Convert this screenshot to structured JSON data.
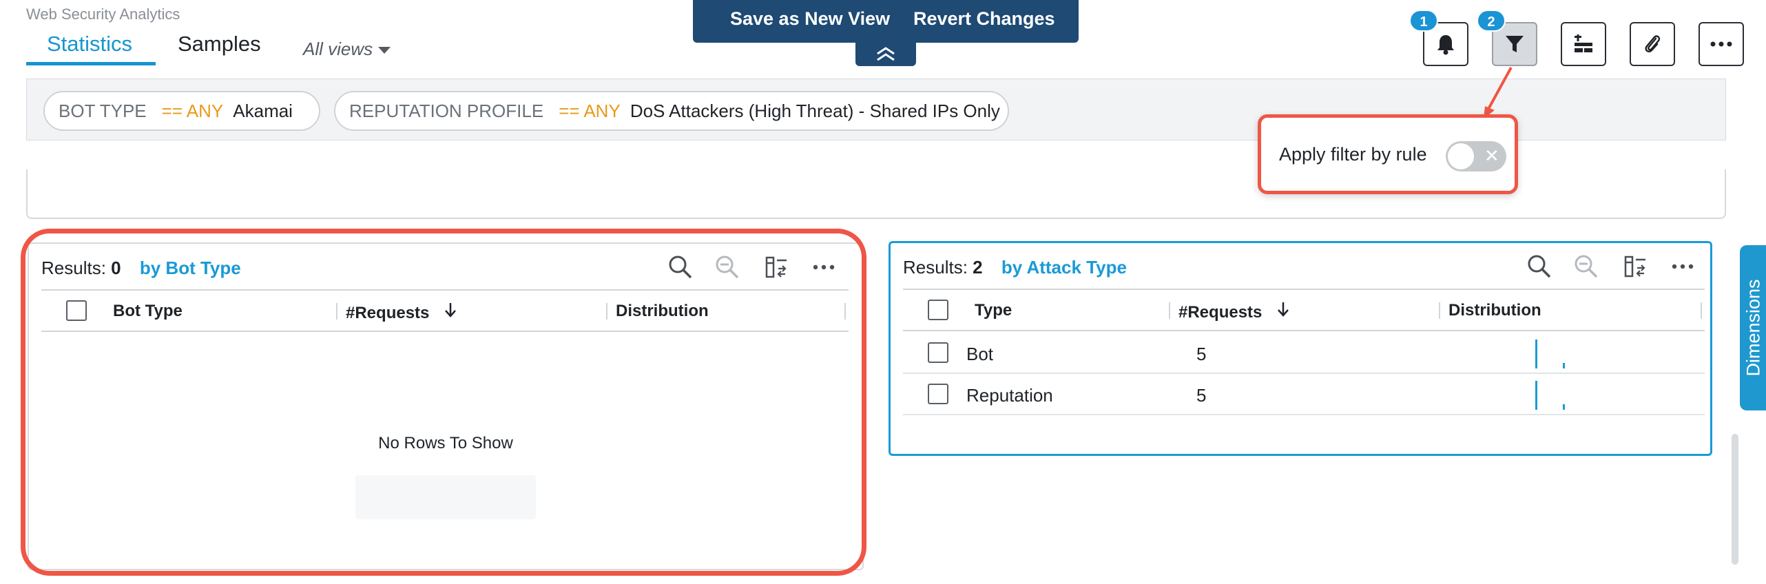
{
  "app": {
    "title": "Web Security Analytics"
  },
  "tabs": [
    {
      "label": "Statistics",
      "active": true
    },
    {
      "label": "Samples",
      "active": false
    }
  ],
  "views": {
    "label": "All views"
  },
  "save_bar": {
    "save_as_new_view": "Save as New View",
    "revert_changes": "Revert Changes"
  },
  "toolbar": {
    "badges": [
      "1",
      "2"
    ],
    "icons": [
      "bell-icon",
      "filter-icon",
      "add-widget-icon",
      "paperclip-icon",
      "more-icon"
    ]
  },
  "filters": [
    {
      "key": "BOT TYPE",
      "operator": "== ANY",
      "value": "Akamai"
    },
    {
      "key": "REPUTATION PROFILE",
      "operator": "== ANY",
      "value": "DoS Attackers (High Threat) - Shared IPs Only"
    }
  ],
  "apply_filter": {
    "label": "Apply filter by rule",
    "enabled": false
  },
  "left_widget": {
    "results_label": "Results:",
    "results_count": "0",
    "group_by": "by Bot Type",
    "columns": [
      "Bot Type",
      "#Requests",
      "Distribution"
    ],
    "empty_message": "No Rows To Show"
  },
  "right_widget": {
    "results_label": "Results:",
    "results_count": "2",
    "group_by": "by Attack Type",
    "columns": [
      "Type",
      "#Requests",
      "Distribution"
    ],
    "rows": [
      {
        "type": "Bot",
        "requests": "5"
      },
      {
        "type": "Reputation",
        "requests": "5"
      }
    ]
  },
  "side_tab": {
    "label": "Dimensions"
  },
  "colors": {
    "accent": "#1a9ad6",
    "save_bar": "#1e4a74",
    "highlight": "#ef5646",
    "operator": "#e89a1a"
  }
}
